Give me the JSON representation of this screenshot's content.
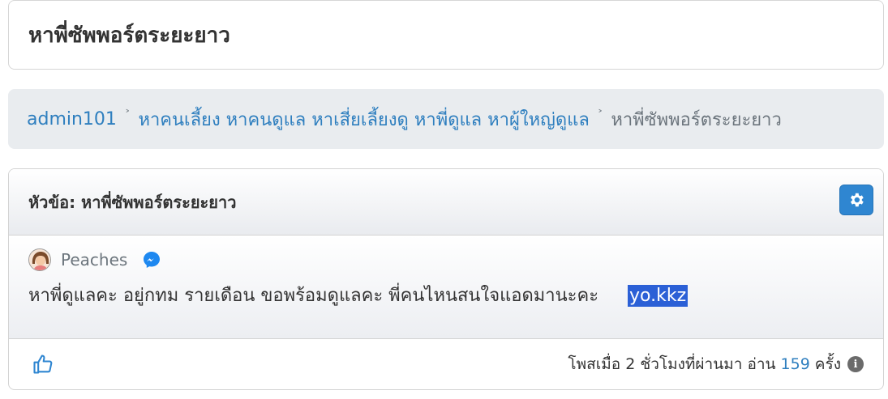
{
  "page": {
    "title": "หาพี่ซัพพอร์ตระยะยาว"
  },
  "breadcrumb": {
    "items": [
      "admin101",
      "หาคนเลี้ยง หาคนดูแล หาเสี่ยเลี้ยงดู หาพี่ดูแล หาผู้ใหญ่ดูแล"
    ],
    "separator": "˃",
    "current": "หาพี่ซัพพอร์ตระยะยาว"
  },
  "post": {
    "topic": "หัวข้อ: หาพี่ซัพพอร์ตระยะยาว",
    "settings_icon": "gear-icon",
    "author": "Peaches",
    "contact_icon": "messenger-icon",
    "message": "หาพี่ดูแลคะ  อยู่กทม รายเดือน ขอพร้อมดูแลคะ พี่คนไหนสนใจแอดมานะคะ",
    "highlight": "yo.kkz",
    "posted": "โพสเมื่อ 2 ชั่วโมงที่ผ่านมา อ่าน",
    "views": "159",
    "views_unit": "ครั้ง",
    "like_icon": "thumbs-up-icon",
    "info_icon": "info-icon",
    "info_glyph": "i"
  },
  "colors": {
    "link": "#2f7fbf",
    "accent": "#2f86d1",
    "highlight_bg": "#2b60d6"
  }
}
